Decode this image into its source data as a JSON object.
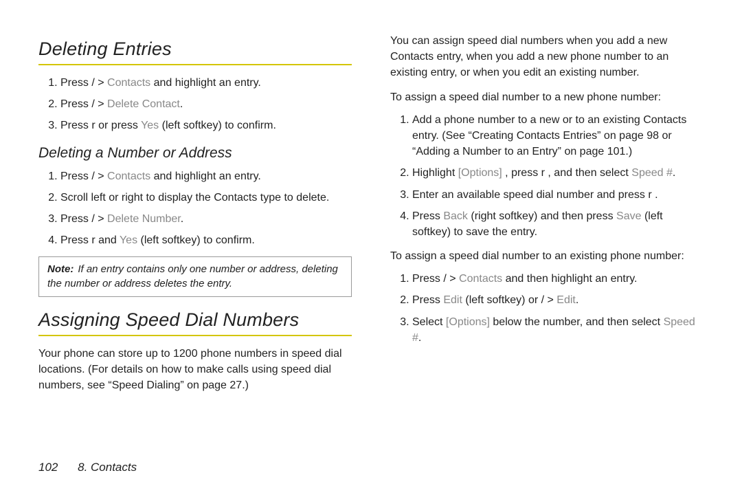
{
  "left": {
    "h1a": "Deleting Entries",
    "ol1": {
      "i1": {
        "a": "Press /",
        "b": " > ",
        "c": "Contacts",
        "d": " and highlight an entry."
      },
      "i2": {
        "a": "Press /",
        "b": " > ",
        "c": "Delete Contact",
        "d": "."
      },
      "i3": {
        "a": "Press r",
        "b": "   or press ",
        "c": "Yes",
        "d": " (left softkey) to confirm."
      }
    },
    "h2a": "Deleting a Number or Address",
    "ol2": {
      "i1": {
        "a": "Press /",
        "b": " > ",
        "c": "Contacts",
        "d": " and highlight an entry."
      },
      "i2": {
        "a": "Scroll left or right to display the Contacts type to delete."
      },
      "i3": {
        "a": "Press /",
        "b": " > ",
        "c": "Delete Number",
        "d": "."
      },
      "i4": {
        "a": "Press r",
        "b": "   and ",
        "c": "Yes",
        "d": " (left softkey) to confirm."
      }
    },
    "note": {
      "label": "Note:",
      "text": "If an entry contains only one number or address, deleting the number or address deletes the entry."
    },
    "h1b": "Assigning Speed Dial Numbers",
    "p1": "Your phone can store up to 1200 phone numbers in speed dial locations. (For details on how to make calls using speed dial numbers, see “Speed Dialing” on page 27.)"
  },
  "right": {
    "p1": "You can assign speed dial numbers when you add a new Contacts entry, when you add a new phone number to an existing entry, or when you edit an existing number.",
    "lead1": "To assign a speed dial number to a new phone number:",
    "ol1": {
      "i1": {
        "a": "Add a phone number to a new or to an existing Contacts entry. (See “Creating Contacts Entries” on page 98 or “Adding a Number to an Entry” on page 101.)"
      },
      "i2": {
        "a": "Highlight ",
        "b": "[Options]",
        "c": " , press r",
        "d": "  , and then select ",
        "e": "Speed #",
        "f": "."
      },
      "i3": {
        "a": "Enter an available speed dial number and press r",
        "b": "  ."
      },
      "i4": {
        "a": "Press ",
        "b": "Back",
        "c": " (right softkey) and then press ",
        "d": "Save",
        "e": " (left softkey) to save the entry."
      }
    },
    "lead2": "To assign a speed dial number to an existing phone number:",
    "ol2": {
      "i1": {
        "a": "Press /",
        "b": "   > ",
        "c": "Contacts",
        "d": " and then highlight an entry."
      },
      "i2": {
        "a": "Press ",
        "b": "Edit",
        "c": " (left softkey) or /",
        "d": "   > ",
        "e": "Edit",
        "f": "."
      },
      "i3": {
        "a": "Select ",
        "b": "[Options]",
        "c": " below the number, and then select ",
        "d": "Speed #",
        "e": "."
      }
    }
  },
  "footer": {
    "page": "102",
    "section": "8. Contacts"
  }
}
